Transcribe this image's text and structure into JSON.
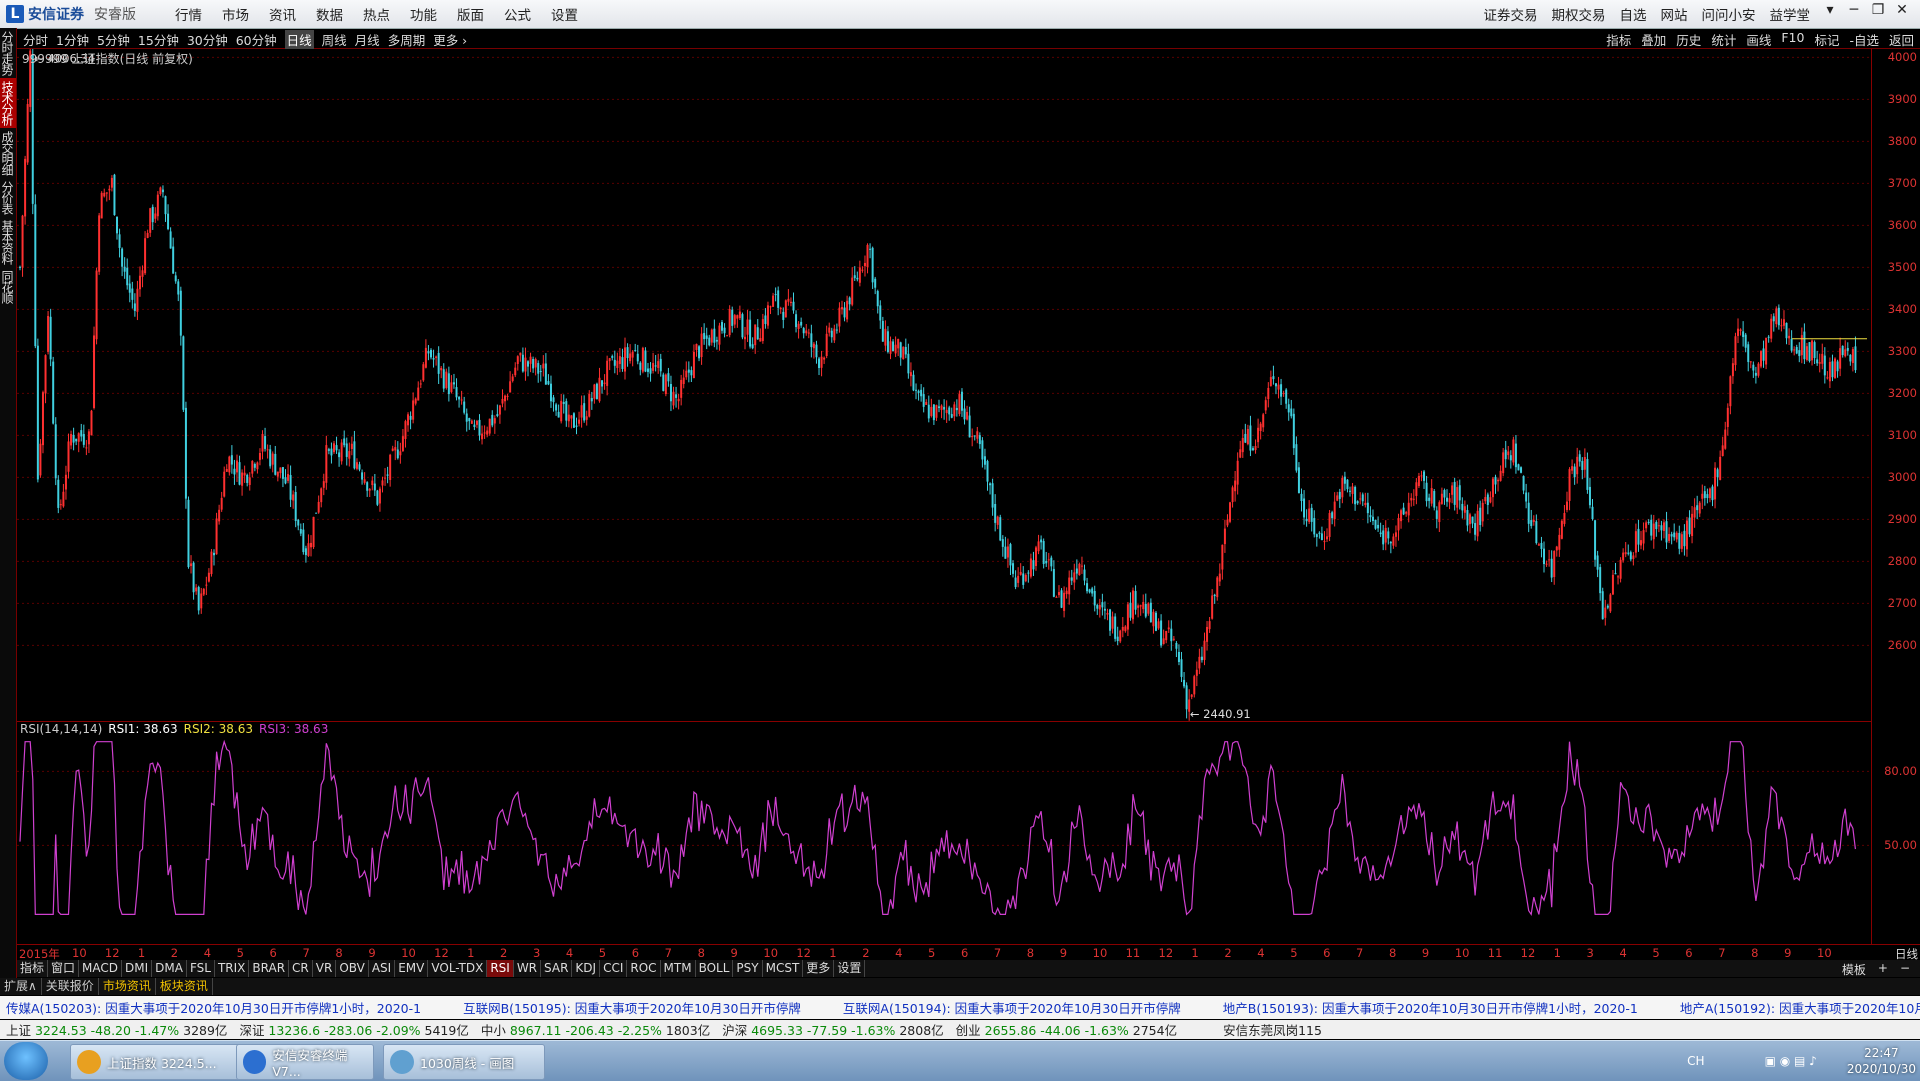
{
  "menubar": {
    "brand": "安信证券",
    "edition": "安睿版",
    "items": [
      "行情",
      "市场",
      "资讯",
      "数据",
      "热点",
      "功能",
      "版面",
      "公式",
      "设置"
    ],
    "right_items": [
      "证券交易",
      "期权交易",
      "自选",
      "网站",
      "问问小安",
      "益学堂"
    ],
    "window_buttons": [
      "▾",
      "─",
      "❐",
      "✕"
    ]
  },
  "left_tabs": [
    {
      "label": "分时走势",
      "active": false
    },
    {
      "label": "技术分析",
      "active": true
    },
    {
      "label": "成交明细",
      "active": false
    },
    {
      "label": "分价表",
      "active": false
    },
    {
      "label": "基本资料",
      "active": false
    },
    {
      "label": "同花顺",
      "active": false
    }
  ],
  "periods": [
    "分时",
    "1分钟",
    "5分钟",
    "15分钟",
    "30分钟",
    "60分钟",
    "日线",
    "周线",
    "月线",
    "多周期",
    "更多 ›"
  ],
  "selected_period": "日线",
  "toolbar_right": [
    "指标",
    "叠加",
    "历史",
    "统计",
    "画线",
    "F10",
    "标记",
    "-自选",
    "返回"
  ],
  "main_chart": {
    "title": "999999 上证指数(日线 前复权)",
    "high_label": "4006.34",
    "low_label": "2440.91",
    "y_ticks": [
      "4000",
      "3900",
      "3800",
      "3700",
      "3600",
      "3500",
      "3400",
      "3300",
      "3200",
      "3100",
      "3000",
      "2900",
      "2800",
      "2700",
      "2600"
    ]
  },
  "rsi": {
    "title": "RSI(14,14,14)",
    "rsi1": "RSI1: 38.63",
    "rsi2": "RSI2: 38.63",
    "rsi3": "RSI3: 38.63",
    "y_ticks": [
      "80.00",
      "50.00"
    ]
  },
  "date_axis": {
    "start": "2015年",
    "labels": [
      "10",
      "12",
      "1",
      "2",
      "4",
      "5",
      "6",
      "7",
      "8",
      "9",
      "10",
      "12",
      "1",
      "2",
      "3",
      "4",
      "5",
      "6",
      "7",
      "8",
      "9",
      "10",
      "12",
      "1",
      "2",
      "4",
      "5",
      "6",
      "7",
      "8",
      "9",
      "10",
      "11",
      "12",
      "1",
      "2",
      "4",
      "5",
      "6",
      "7",
      "8",
      "9",
      "10",
      "11",
      "12",
      "1",
      "3",
      "4",
      "5",
      "6",
      "7",
      "8",
      "9",
      "10"
    ],
    "end_label": "日线"
  },
  "indicator_tabs": [
    "指标",
    "窗口",
    "MACD",
    "DMI",
    "DMA",
    "FSL",
    "TRIX",
    "BRAR",
    "CR",
    "VR",
    "OBV",
    "ASI",
    "EMV",
    "VOL-TDX",
    "RSI",
    "WR",
    "SAR",
    "KDJ",
    "CCI",
    "ROC",
    "MTM",
    "BOLL",
    "PSY",
    "MCST",
    "更多",
    "设置"
  ],
  "selected_indicator": "RSI",
  "indicator_right": [
    "模板",
    "+",
    "−"
  ],
  "ext_tabs": [
    {
      "label": "扩展∧",
      "sel": false
    },
    {
      "label": "关联报价",
      "sel": false
    },
    {
      "label": "市场资讯",
      "sel": true
    },
    {
      "label": "板块资讯",
      "sel": true
    }
  ],
  "news": [
    "传媒A(150203): 因重大事项于2020年10月30日开市停牌1小时，2020-1",
    "互联网B(150195): 因重大事项于2020年10月30日开市停牌",
    "互联网A(150194): 因重大事项于2020年10月30日开市停牌",
    "地产B(150193): 因重大事项于2020年10月30日开市停牌1小时，2020-1",
    "地产A(150192): 因重大事项于2020年10月30日开市停牌1小时，2020-1"
  ],
  "indices": [
    {
      "name": "上证",
      "value": "3224.53 -48.20 -1.47%",
      "amount": "3289亿"
    },
    {
      "name": "深证",
      "value": "13236.6 -283.06 -2.09%",
      "amount": "5419亿"
    },
    {
      "name": "中小",
      "value": "8967.11 -206.43 -2.25%",
      "amount": "1803亿"
    },
    {
      "name": "沪深",
      "value": "4695.33 -77.59 -1.63%",
      "amount": "2808亿"
    },
    {
      "name": "创业",
      "value": "2655.86 -44.06 -1.63%",
      "amount": "2754亿"
    }
  ],
  "branch": "安信东莞凤岗115",
  "taskbar": {
    "tasks": [
      "上证指数 3224.5...",
      "安信安睿终端V7...",
      "1030周线 - 画图"
    ],
    "lang": "CH",
    "time": "22:47",
    "date": "2020/10/30"
  },
  "colors": {
    "up": "#ff3030",
    "down": "#40d0e0",
    "rsi": "#d040d0",
    "axis": "#dd3333"
  }
}
